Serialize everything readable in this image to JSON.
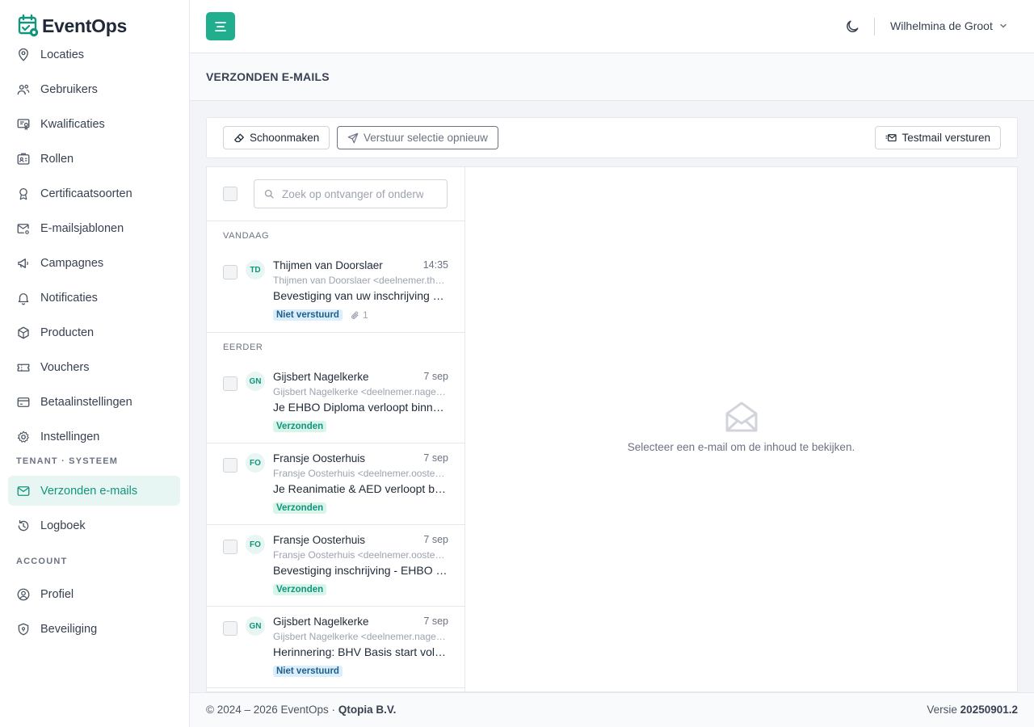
{
  "app": {
    "name": "EventOps"
  },
  "sidebar": {
    "items_top": [
      {
        "label": "Locaties",
        "icon": "map-pin-icon"
      },
      {
        "label": "Gebruikers",
        "icon": "users-icon"
      },
      {
        "label": "Kwalificaties",
        "icon": "certificate-icon"
      },
      {
        "label": "Rollen",
        "icon": "id-badge-icon"
      },
      {
        "label": "Certificaatsoorten",
        "icon": "award-icon"
      },
      {
        "label": "E-mailsjablonen",
        "icon": "mail-template-icon"
      },
      {
        "label": "Campagnes",
        "icon": "megaphone-icon"
      },
      {
        "label": "Notificaties",
        "icon": "bell-icon"
      },
      {
        "label": "Producten",
        "icon": "package-icon"
      },
      {
        "label": "Vouchers",
        "icon": "ticket-icon"
      },
      {
        "label": "Betaalinstellingen",
        "icon": "credit-card-icon"
      },
      {
        "label": "Instellingen",
        "icon": "gear-icon"
      }
    ],
    "section_tenant": "TENANT · SYSTEEM",
    "items_tenant": [
      {
        "label": "Verzonden e-mails",
        "icon": "mail-icon",
        "active": true
      },
      {
        "label": "Logboek",
        "icon": "history-icon"
      }
    ],
    "section_account": "ACCOUNT",
    "items_account": [
      {
        "label": "Profiel",
        "icon": "user-circle-icon"
      },
      {
        "label": "Beveiliging",
        "icon": "shield-icon"
      }
    ]
  },
  "header": {
    "user_name": "Wilhelmina de Groot"
  },
  "page": {
    "title": "VERZONDEN E-MAILS"
  },
  "toolbar": {
    "clean_label": "Schoonmaken",
    "resend_label": "Verstuur selectie opnieuw",
    "testmail_label": "Testmail versturen"
  },
  "search": {
    "placeholder": "Zoek op ontvanger of onderwerp"
  },
  "groups": {
    "today_label": "VANDAAG",
    "earlier_label": "EERDER"
  },
  "mails_today": [
    {
      "initials": "TD",
      "from": "Thijmen van Doorslaer",
      "time": "14:35",
      "address": "Thijmen van Doorslaer <deelnemer.thijmen@example.nl>",
      "subject": "Bevestiging van uw inschrijving voor de training",
      "status": "Niet verstuurd",
      "status_type": "unsent",
      "attachments": "1"
    }
  ],
  "mails_earlier": [
    {
      "initials": "GN",
      "from": "Gijsbert Nagelkerke",
      "time": "7 sep",
      "address": "Gijsbert Nagelkerke <deelnemer.nagelkerke@example.nl>",
      "subject": "Je EHBO Diploma verloopt binnenkort",
      "status": "Verzonden",
      "status_type": "sent"
    },
    {
      "initials": "FO",
      "from": "Fransje Oosterhuis",
      "time": "7 sep",
      "address": "Fransje Oosterhuis <deelnemer.oosterhuis@example.nl>",
      "subject": "Je Reanimatie & AED verloopt binnenkort",
      "status": "Verzonden",
      "status_type": "sent"
    },
    {
      "initials": "FO",
      "from": "Fransje Oosterhuis",
      "time": "7 sep",
      "address": "Fransje Oosterhuis <deelnemer.oosterhuis@example.nl>",
      "subject": "Bevestiging inschrijving - EHBO Basis",
      "status": "Verzonden",
      "status_type": "sent"
    },
    {
      "initials": "GN",
      "from": "Gijsbert Nagelkerke",
      "time": "7 sep",
      "address": "Gijsbert Nagelkerke <deelnemer.nagelkerke@example.nl>",
      "subject": "Herinnering: BHV Basis start volgende week",
      "status": "Niet verstuurd",
      "status_type": "unsent"
    }
  ],
  "preview": {
    "empty_text": "Selecteer een e-mail om de inhoud te bekijken."
  },
  "footer": {
    "copyright": "© 2024 – 2026 EventOps ·",
    "company": "Qtopia B.V.",
    "version_label": "Versie",
    "version": "20250901.2"
  },
  "colors": {
    "accent": "#20ae8f",
    "accent_dark": "#12957c",
    "active_bg": "#e7f6f2"
  }
}
